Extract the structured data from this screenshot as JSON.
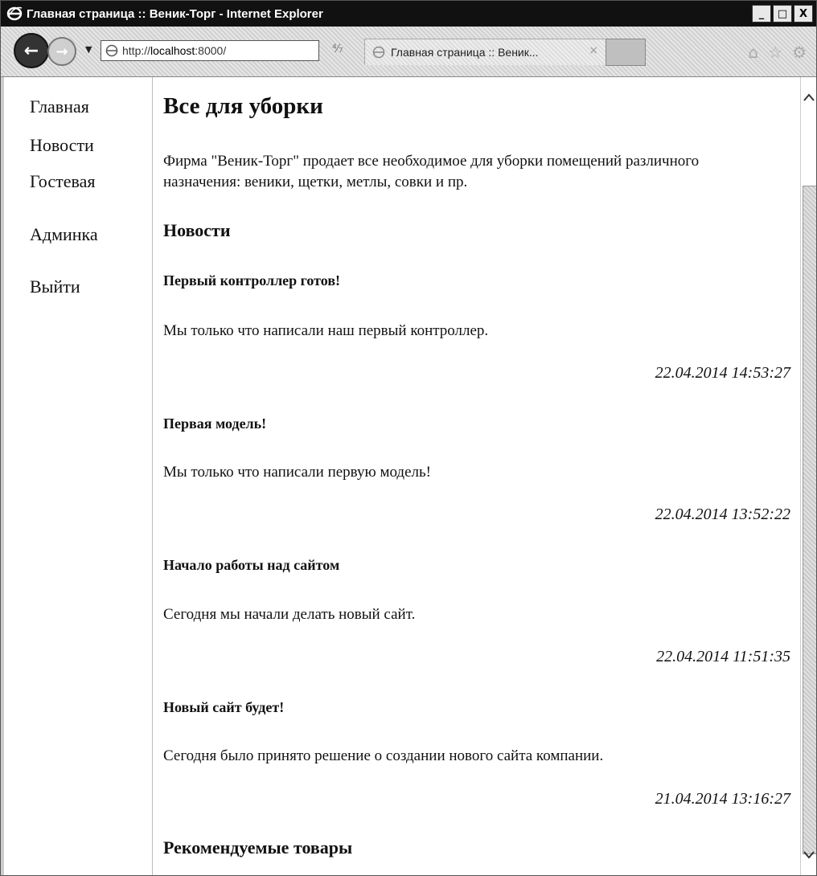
{
  "window": {
    "title": "Главная страница :: Веник-Торг - Internet Explorer",
    "minimize_label": "_",
    "maximize_label": "□",
    "close_label": "X"
  },
  "toolbar": {
    "url_prefix": "http://",
    "url_host": "localhost",
    "url_suffix": ":8000/",
    "tab_label": "Главная страница :: Веник...",
    "tab_close": "×",
    "back_glyph": "←",
    "forward_glyph": "→",
    "refresh_glyph": "⁴⁄₇",
    "icons": [
      "home-icon",
      "favorites-star-icon",
      "tools-gear-icon"
    ]
  },
  "sidebar": {
    "items": [
      {
        "label": "Главная"
      },
      {
        "label": "Новости"
      },
      {
        "label": "Гостевая"
      },
      {
        "label": "Админка"
      },
      {
        "label": "Выйти"
      }
    ]
  },
  "main": {
    "title": "Все для уборки",
    "intro": "Фирма \"Веник-Торг\" продает все необходимое для уборки помещений различного назначения: веники, щетки, метлы, совки и пр.",
    "news_heading": "Новости",
    "news": [
      {
        "title": "Первый контроллер готов!",
        "text": "Мы только что написали наш первый контроллер.",
        "date": "22.04.2014 14:53:27"
      },
      {
        "title": "Первая модель!",
        "text": "Мы только что написали первую модель!",
        "date": "22.04.2014 13:52:22"
      },
      {
        "title": "Начало работы над сайтом",
        "text": "Сегодня мы начали делать новый сайт.",
        "date": "22.04.2014 11:51:35"
      },
      {
        "title": "Новый сайт будет!",
        "text": "Сегодня было принято решение о создании нового сайта компании.",
        "date": "21.04.2014 13:16:27"
      }
    ],
    "recommended_heading": "Рекомендуемые товары"
  },
  "scrollbar": {
    "up_glyph": "^",
    "down_glyph": "v"
  }
}
